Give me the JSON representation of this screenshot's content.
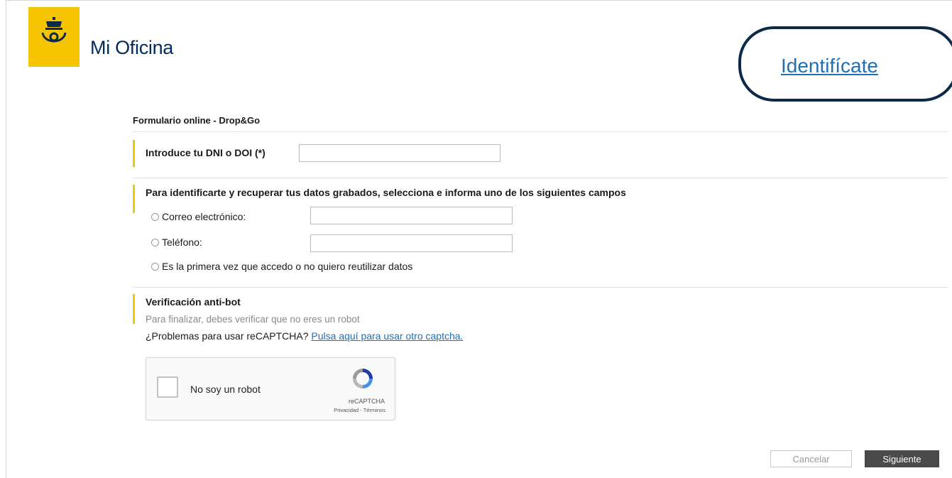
{
  "header": {
    "app_title": "Mi Oficina",
    "login_link": "Identifícate",
    "brand_color": "#f6c400",
    "logo_icon": "postal-horn-crown-icon"
  },
  "form": {
    "title": "Formulario online - Drop&Go",
    "dni": {
      "label": "Introduce tu DNI o DOI (*)",
      "value": "",
      "placeholder": ""
    },
    "identify": {
      "heading": "Para identificarte y recuperar tus datos grabados, selecciona e informa uno de los siguientes campos",
      "options": [
        {
          "label": "Correo electrónico:",
          "value": ""
        },
        {
          "label": "Teléfono:",
          "value": ""
        },
        {
          "label": "Es la primera vez que accedo o no quiero reutilizar datos"
        }
      ]
    },
    "antibot": {
      "heading": "Verificación anti-bot",
      "hint": "Para finalizar, debes verificar que no eres un robot",
      "problem_text": "¿Problemas para usar reCAPTCHA?",
      "problem_link": "Pulsa aquí para usar otro captcha.",
      "recaptcha": {
        "label": "No soy un robot",
        "brand": "reCAPTCHA",
        "links": "Privacidad - Términos"
      }
    }
  },
  "buttons": {
    "cancel": "Cancelar",
    "next": "Siguiente"
  }
}
